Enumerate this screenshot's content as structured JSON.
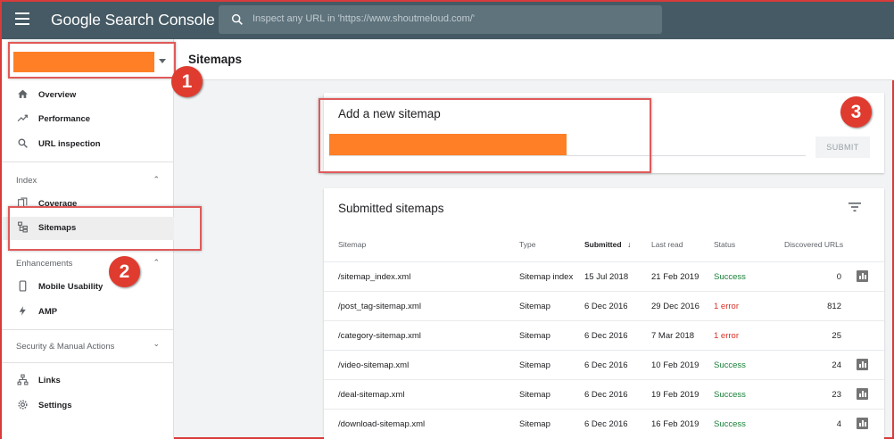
{
  "app": {
    "title": "Google Search Console"
  },
  "search": {
    "placeholder": "Inspect any URL in 'https://www.shoutmeloud.com/'"
  },
  "sidebar": {
    "top_items": [
      {
        "label": "Overview",
        "icon": "home-icon"
      },
      {
        "label": "Performance",
        "icon": "trending-icon"
      },
      {
        "label": "URL inspection",
        "icon": "search-icon"
      }
    ],
    "index_section": "Index",
    "index_items": [
      {
        "label": "Coverage",
        "icon": "coverage-icon"
      },
      {
        "label": "Sitemaps",
        "icon": "sitemap-icon"
      }
    ],
    "enhancements_section": "Enhancements",
    "enhancement_items": [
      {
        "label": "Mobile Usability",
        "icon": "phone-icon"
      },
      {
        "label": "AMP",
        "icon": "bolt-icon"
      }
    ],
    "security_section": "Security & Manual Actions",
    "bottom_items": [
      {
        "label": "Links",
        "icon": "links-icon"
      },
      {
        "label": "Settings",
        "icon": "gear-icon"
      }
    ]
  },
  "page": {
    "title": "Sitemaps"
  },
  "add_sitemap": {
    "title": "Add a new sitemap",
    "submit_label": "SUBMIT"
  },
  "submitted": {
    "title": "Submitted sitemaps",
    "columns": [
      "Sitemap",
      "Type",
      "Submitted",
      "Last read",
      "Status",
      "Discovered URLs"
    ],
    "rows": [
      {
        "sitemap": "/sitemap_index.xml",
        "type": "Sitemap index",
        "submitted": "15 Jul 2018",
        "last_read": "21 Feb 2019",
        "status": "Success",
        "urls": "0",
        "chart": true
      },
      {
        "sitemap": "/post_tag-sitemap.xml",
        "type": "Sitemap",
        "submitted": "6 Dec 2016",
        "last_read": "29 Dec 2016",
        "status": "1 error",
        "urls": "812",
        "chart": false
      },
      {
        "sitemap": "/category-sitemap.xml",
        "type": "Sitemap",
        "submitted": "6 Dec 2016",
        "last_read": "7 Mar 2018",
        "status": "1 error",
        "urls": "25",
        "chart": false
      },
      {
        "sitemap": "/video-sitemap.xml",
        "type": "Sitemap",
        "submitted": "6 Dec 2016",
        "last_read": "10 Feb 2019",
        "status": "Success",
        "urls": "24",
        "chart": true
      },
      {
        "sitemap": "/deal-sitemap.xml",
        "type": "Sitemap",
        "submitted": "6 Dec 2016",
        "last_read": "19 Feb 2019",
        "status": "Success",
        "urls": "23",
        "chart": true
      },
      {
        "sitemap": "/download-sitemap.xml",
        "type": "Sitemap",
        "submitted": "6 Dec 2016",
        "last_read": "16 Feb 2019",
        "status": "Success",
        "urls": "4",
        "chart": true
      }
    ]
  },
  "annotations": [
    "1",
    "2",
    "3"
  ],
  "colors": {
    "topbar": "#455a64",
    "redacted": "#ff7f27",
    "annotation": "#e03b2f",
    "success": "#188038",
    "error": "#d93025"
  }
}
